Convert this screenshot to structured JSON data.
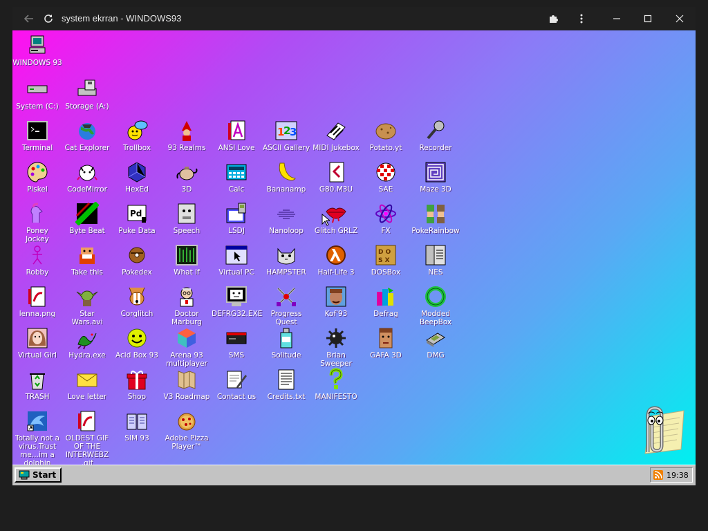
{
  "browser": {
    "title": "system ekrran - WINDOWS93"
  },
  "taskbar": {
    "start_label": "Start",
    "clock": "19:38"
  },
  "icons": {
    "windows93": "WINDOWS 93",
    "system_c": "System (C:)",
    "storage_a": "Storage (A:)",
    "terminal": "Terminal",
    "cat_explorer": "Cat Explorer",
    "trollbox": "Trollbox",
    "realms": "93 Realms",
    "ansi_love": "ANSI Love",
    "ascii_gallery": "ASCII Gallery",
    "midi_jukebox": "MIDI Jukebox",
    "potato": "Potato.yt",
    "recorder": "Recorder",
    "piskel": "Piskel",
    "codemirror": "CodeMirror",
    "hexed": "HexEd",
    "threed": "3D",
    "calc": "Calc",
    "bananamp": "Bananamp",
    "g80": "G80.M3U",
    "sae": "SAE",
    "maze3d": "Maze 3D",
    "poney_1": "Poney",
    "poney_2": "Jockey",
    "byte_beat": "Byte Beat",
    "puke_data": "Puke Data",
    "speech": "Speech",
    "lsdj": "LSDJ",
    "nanoloop": "Nanoloop",
    "glitch_grlz": "Glitch GRLZ",
    "fx": "FX",
    "pokerainbow": "PokeRainbow",
    "robby": "Robby",
    "take_this": "Take this",
    "poke": "Pokedex",
    "what_if": "What If",
    "virtual_pc": "Virtual PC",
    "hampster": "HAMPSTER",
    "half_life": "Half-Life 3",
    "dosbox": "DOSBox",
    "nes": "NES",
    "lenna": "lenna.png",
    "star_wars_1": "Star",
    "star_wars_2": "Wars.avi",
    "corglitch": "Corglitch",
    "doctor_1": "Doctor",
    "doctor_2": "Marburg",
    "defrag32": "DEFRG32.EXE",
    "progress_1": "Progress",
    "progress_2": "Quest",
    "kof93": "Kof'93",
    "defrag": "Defrag",
    "modded_1": "Modded",
    "modded_2": "BeepBox",
    "virtual_girl": "Virtual Girl",
    "hydra": "Hydra.exe",
    "acid_box": "Acid Box 93",
    "arena_1": "Arena 93",
    "arena_2": "multiplayer",
    "sms": "SMS",
    "solitude": "Solitude",
    "brian_1": "Brian",
    "brian_2": "Sweeper",
    "gafa": "GAFA 3D",
    "dmg": "DMG",
    "trash": "TRASH",
    "love_letter": "Love letter",
    "shop": "Shop",
    "v3_roadmap": "V3 Roadmap",
    "contact_us": "Contact us",
    "credits": "Credits.txt",
    "manifesto": "MANIFESTO",
    "dolphin_1": "Totally not a",
    "dolphin_2": "virus.Trust",
    "dolphin_3": "me...im a",
    "dolphin_4": "dolphin",
    "gif_1": "OLDEST GIF",
    "gif_2": "OF THE",
    "gif_3": "INTERWEBZ",
    "gif_4": ".gif",
    "sim93": "SIM 93",
    "pizza_1": "Adobe Pizza",
    "pizza_2": "Player™"
  }
}
